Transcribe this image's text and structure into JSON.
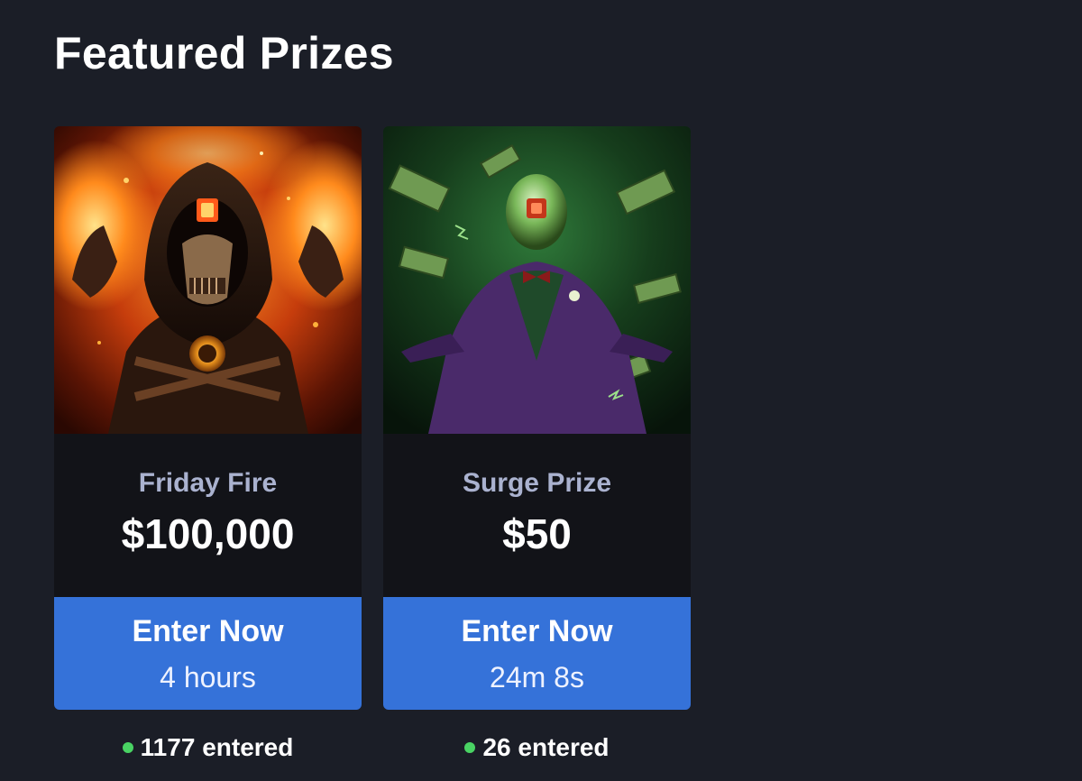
{
  "page": {
    "title": "Featured Prizes"
  },
  "colors": {
    "background": "#1b1e27",
    "card_info_bg": "#121318",
    "prize_name": "#aab2cf",
    "button": "#3572d9",
    "status_dot": "#49d363"
  },
  "prizes": [
    {
      "name": "Friday Fire",
      "amount": "$100,000",
      "button_label": "Enter Now",
      "time_remaining": "4 hours",
      "entered_count": "1177",
      "entered_label": "entered",
      "art": "hooded-fire-warrior-image"
    },
    {
      "name": "Surge Prize",
      "amount": "$50",
      "button_label": "Enter Now",
      "time_remaining": "24m 8s",
      "entered_count": "26",
      "entered_label": "entered",
      "art": "green-suited-money-figure-image"
    }
  ]
}
